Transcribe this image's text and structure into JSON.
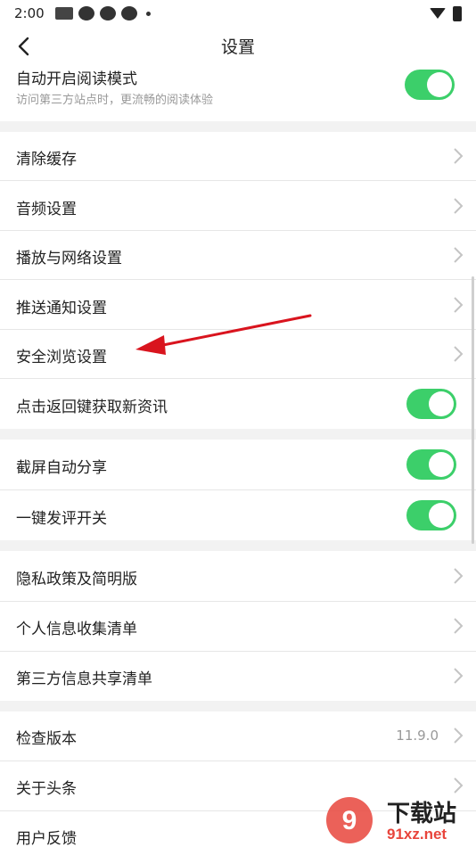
{
  "status_bar": {
    "time": "2:00"
  },
  "nav": {
    "title": "设置"
  },
  "reading_mode": {
    "label": "自动开启阅读模式",
    "subtitle": "访问第三方站点时，更流畅的阅读体验"
  },
  "group1": [
    {
      "label": "清除缓存"
    },
    {
      "label": "音频设置"
    },
    {
      "label": "播放与网络设置"
    },
    {
      "label": "推送通知设置"
    },
    {
      "label": "安全浏览设置"
    },
    {
      "label": "点击返回键获取新资讯"
    }
  ],
  "group2": [
    {
      "label": "截屏自动分享"
    },
    {
      "label": "一键发评开关"
    }
  ],
  "group3": [
    {
      "label": "隐私政策及简明版"
    },
    {
      "label": "个人信息收集清单"
    },
    {
      "label": "第三方信息共享清单"
    }
  ],
  "group4": [
    {
      "label": "检查版本",
      "value": "11.9.0"
    },
    {
      "label": "关于头条"
    },
    {
      "label": "用户反馈"
    }
  ],
  "colors": {
    "toggle_on": "#3ccf6a",
    "annotation_arrow": "#d9141e"
  },
  "watermark": {
    "brand": "下载站",
    "domain": "91xz.net"
  }
}
